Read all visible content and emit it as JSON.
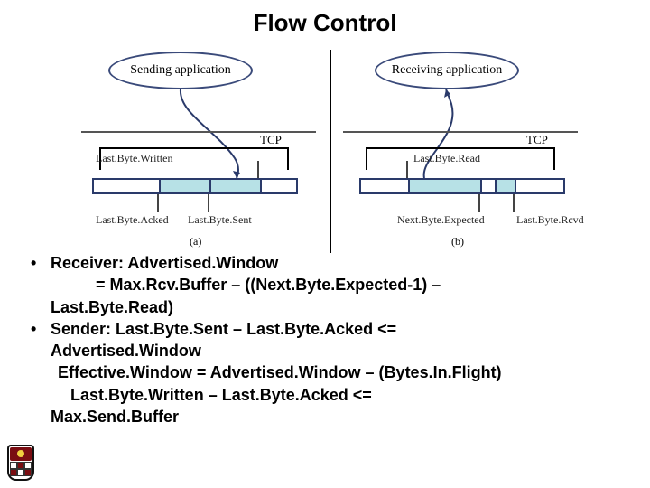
{
  "title": "Flow Control",
  "diagram": {
    "sending_app": "Sending application",
    "receiving_app": "Receiving application",
    "tcp": "TCP",
    "last_byte_written": "Last.Byte.Written",
    "last_byte_acked": "Last.Byte.Acked",
    "last_byte_sent": "Last.Byte.Sent",
    "last_byte_read": "Last.Byte.Read",
    "next_byte_expected": "Next.Byte.Expected",
    "last_byte_rcvd": "Last.Byte.Rcvd",
    "sub_a": "(a)",
    "sub_b": "(b)"
  },
  "bullets": {
    "b1_lead": "Receiver: Advertised.Window",
    "b1_l2": "= Max.Rcv.Buffer – ((Next.Byte.Expected-1) –",
    "b1_l3": "Last.Byte.Read)",
    "b2_lead": "Sender: Last.Byte.Sent – Last.Byte.Acked <=",
    "b2_l2": "Advertised.Window",
    "b2_l3": "Effective.Window = Advertised.Window – (Bytes.In.Flight)",
    "b2_l4": "Last.Byte.Written – Last.Byte.Acked <=",
    "b2_l5": "Max.Send.Buffer"
  }
}
